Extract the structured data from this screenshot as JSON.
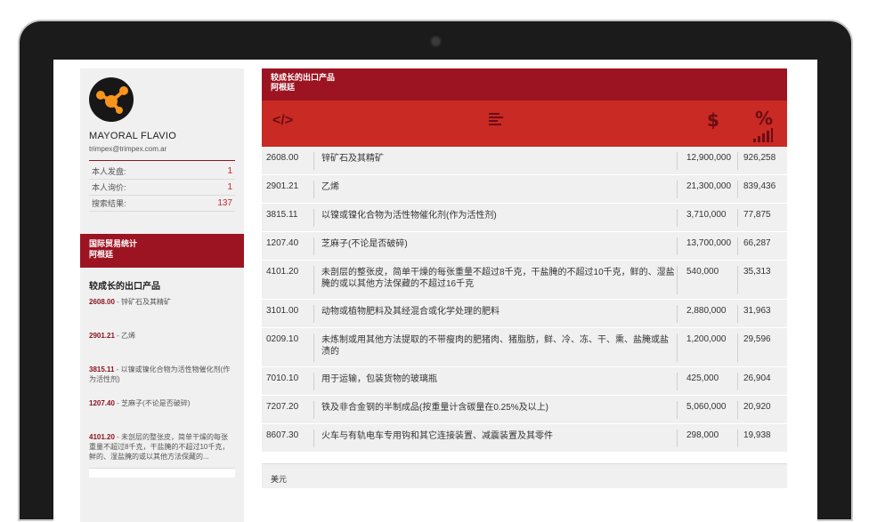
{
  "profile": {
    "name": "MAYORAL FLAVIO",
    "email": "trimpex@trimpex.com.ar",
    "stats": [
      {
        "label": "本人发盘:",
        "value": "1"
      },
      {
        "label": "本人询价:",
        "value": "1"
      },
      {
        "label": "搜索结果:",
        "value": "137"
      }
    ]
  },
  "sidebar": {
    "banner_line1": "国际贸易统计",
    "banner_line2": "阿根廷",
    "section_title": "较成长的出口产品",
    "items": [
      {
        "code": "2608.00",
        "text": " - 锌矿石及其精矿"
      },
      {
        "code": "2901.21",
        "text": " - 乙烯"
      },
      {
        "code": "3815.11",
        "text": " - 以镍或镍化合物为活性物催化剂(作为活性剂)"
      },
      {
        "code": "1207.40",
        "text": " - 芝麻子(不论是否破碎)"
      },
      {
        "code": "4101.20",
        "text": " - 未剖层的整张皮，简单干燥的每张重量不超过8千克，干盐腌的不超过10千克，鲜的、湿盐腌的或以其他方法保藏的..."
      }
    ]
  },
  "main": {
    "header_line1": "较成长的出口产品",
    "header_line2": "阿根廷",
    "icons": [
      "code-icon",
      "lines-icon",
      "dollar-icon",
      "percent-icon",
      "bars-icon"
    ],
    "dollar_symbol": "$",
    "percent_symbol": "%",
    "rows": [
      {
        "code": "2608.00",
        "desc": "锌矿石及其精矿",
        "value": "12,900,000",
        "pct": "926,258"
      },
      {
        "code": "2901.21",
        "desc": "乙烯",
        "value": "21,300,000",
        "pct": "839,436"
      },
      {
        "code": "3815.11",
        "desc": "以镍或镍化合物为活性物催化剂(作为活性剂)",
        "value": "3,710,000",
        "pct": "77,875"
      },
      {
        "code": "1207.40",
        "desc": "芝麻子(不论是否破碎)",
        "value": "13,700,000",
        "pct": "66,287"
      },
      {
        "code": "4101.20",
        "desc": "未剖层的整张皮，简单干燥的每张重量不超过8千克，干盐腌的不超过10千克，鲜的、湿盐腌的或以其他方法保藏的不超过16千克",
        "value": "540,000",
        "pct": "35,313"
      },
      {
        "code": "3101.00",
        "desc": "动物或植物肥料及其经混合或化学处理的肥料",
        "value": "2,880,000",
        "pct": "31,963"
      },
      {
        "code": "0209.10",
        "desc": "未炼制或用其他方法提取的不带瘦肉的肥猪肉、猪脂肪，鲜、冷、冻、干、熏、盐腌或盐渍的",
        "value": "1,200,000",
        "pct": "29,596"
      },
      {
        "code": "7010.10",
        "desc": "用于运输，包装货物的玻璃瓶",
        "value": "425,000",
        "pct": "26,904"
      },
      {
        "code": "7207.20",
        "desc": "铁及非合金钢的半制成品(按重量计含碳量在0.25%及以上)",
        "value": "5,060,000",
        "pct": "20,920"
      },
      {
        "code": "8607.30",
        "desc": "火车与有轨电车专用钩和其它连接装置、减震装置及其零件",
        "value": "298,000",
        "pct": "19,938"
      }
    ],
    "unit_label": "美元"
  },
  "colors": {
    "header_dark_red": "#9c1422",
    "icon_row_red": "#c92a24",
    "accent_code": "#8a1520",
    "stat_value": "#c0262c"
  }
}
